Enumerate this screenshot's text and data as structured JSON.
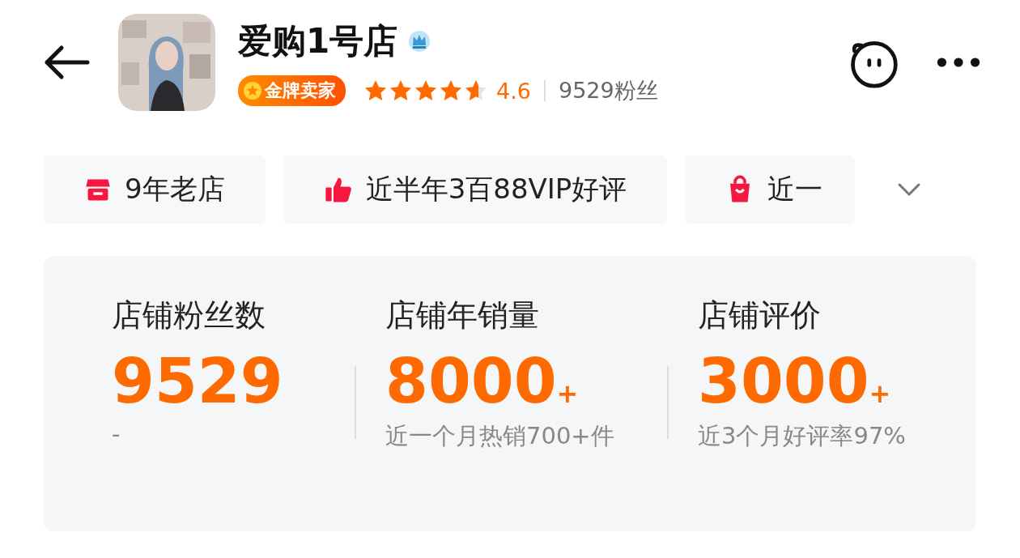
{
  "shop": {
    "name": "爱购1号店",
    "badge": "金牌卖家",
    "stars": 4.6,
    "rating": "4.6",
    "followers": "9529粉丝"
  },
  "tags": [
    {
      "kind": "store",
      "label": "9年老店"
    },
    {
      "kind": "thumb",
      "label": "近半年3百88VIP好评"
    },
    {
      "kind": "bag",
      "label": "近一"
    }
  ],
  "stats": [
    {
      "title": "店铺粉丝数",
      "value": "9529",
      "note": "-"
    },
    {
      "title": "店铺年销量",
      "value": "8000",
      "suffix": "+",
      "note": "近一个月热销700+件"
    },
    {
      "title": "店铺评价",
      "value": "3000",
      "suffix": "+",
      "note": "近3个月好评率97%"
    }
  ]
}
